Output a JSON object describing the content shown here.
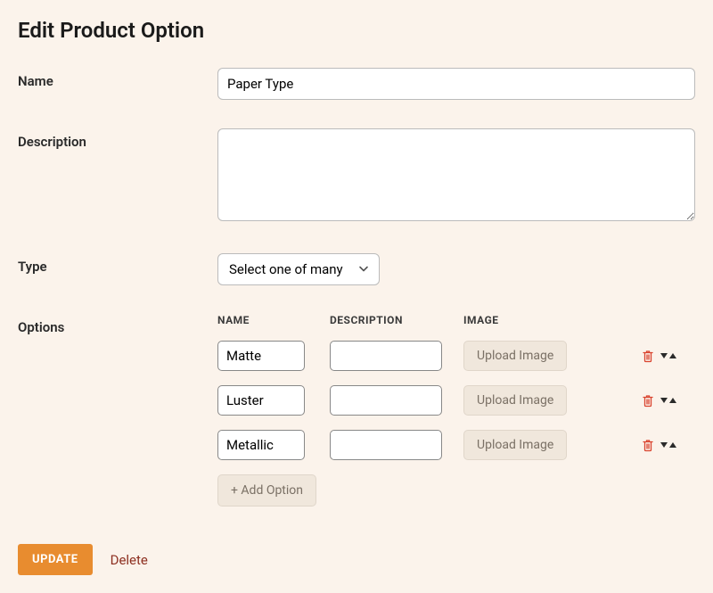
{
  "page_title": "Edit Product Option",
  "labels": {
    "name": "Name",
    "description": "Description",
    "type": "Type",
    "options": "Options"
  },
  "fields": {
    "name_value": "Paper Type",
    "description_value": "",
    "type_selected": "Select one of many"
  },
  "options_table": {
    "headers": {
      "name": "NAME",
      "description": "DESCRIPTION",
      "image": "IMAGE"
    },
    "upload_label": "Upload Image",
    "add_label": "+ Add Option",
    "rows": [
      {
        "name": "Matte",
        "description": ""
      },
      {
        "name": "Luster",
        "description": ""
      },
      {
        "name": "Metallic",
        "description": ""
      }
    ]
  },
  "footer": {
    "update": "UPDATE",
    "delete": "Delete"
  }
}
